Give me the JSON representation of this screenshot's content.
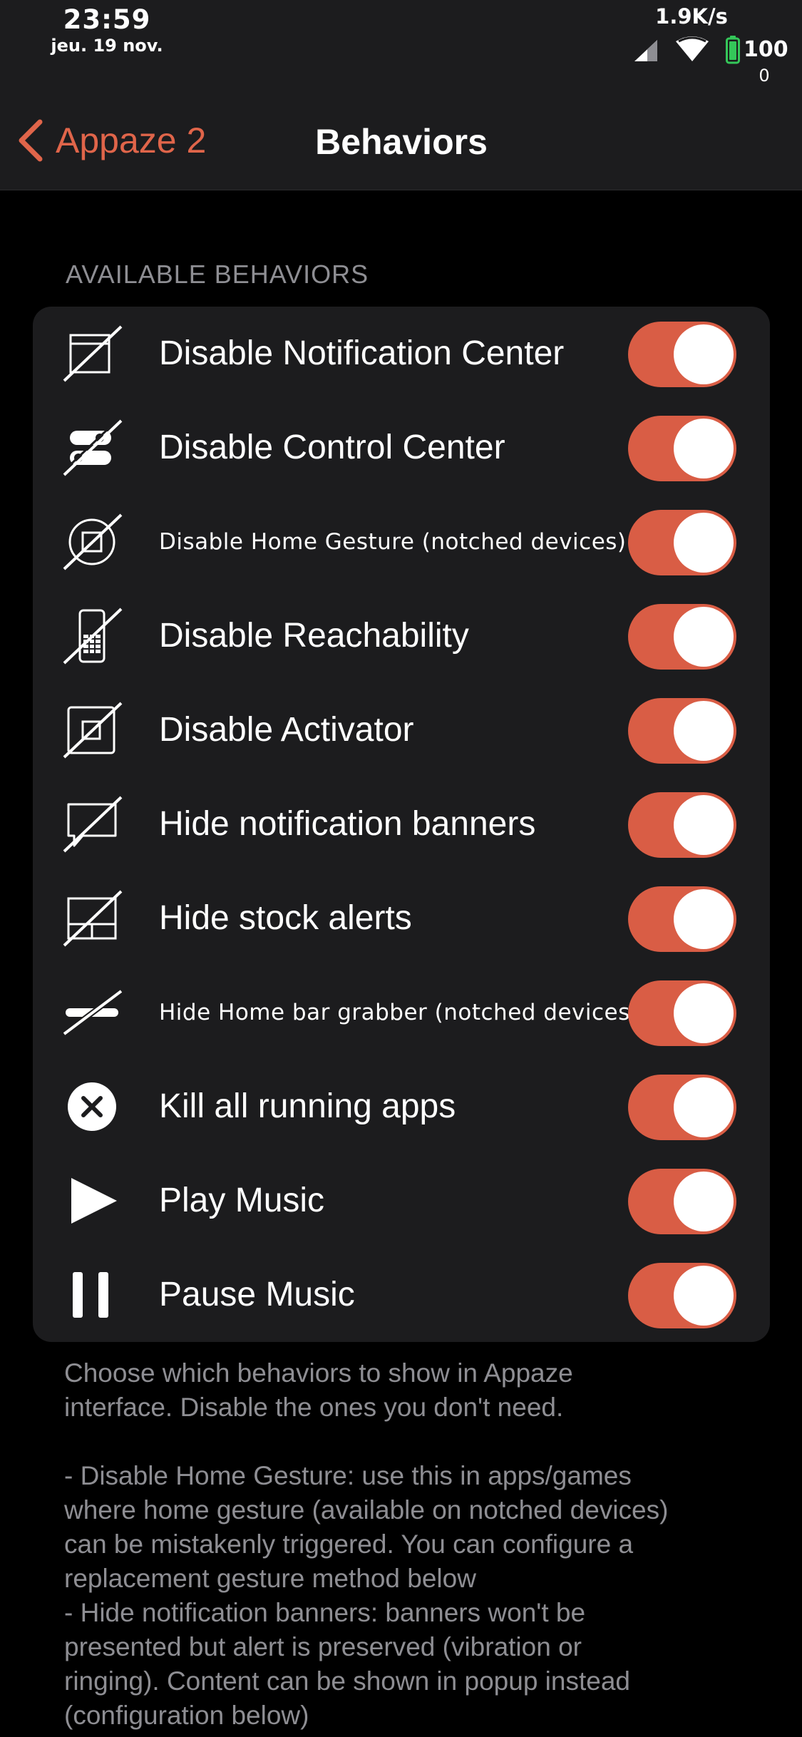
{
  "status_bar": {
    "time": "23:59",
    "date": "jeu. 19 nov.",
    "network_speed": "1.9K/s",
    "battery_level": "100",
    "sub_value": "0",
    "battery_color": "#34c759"
  },
  "nav": {
    "back_label": "Appaze 2",
    "title": "Behaviors",
    "accent_color": "#e0654a"
  },
  "section": {
    "header": "AVAILABLE BEHAVIORS",
    "toggle_on_color": "#d95d45",
    "items": [
      {
        "label": "Disable Notification Center",
        "icon": "notification-center-disabled-icon",
        "enabled": true
      },
      {
        "label": "Disable Control Center",
        "icon": "control-center-disabled-icon",
        "enabled": true
      },
      {
        "label": "Disable Home Gesture (notched devices)",
        "icon": "home-gesture-disabled-icon",
        "enabled": true
      },
      {
        "label": "Disable Reachability",
        "icon": "reachability-disabled-icon",
        "enabled": true
      },
      {
        "label": "Disable Activator",
        "icon": "activator-disabled-icon",
        "enabled": true
      },
      {
        "label": "Hide notification banners",
        "icon": "banner-hidden-icon",
        "enabled": true
      },
      {
        "label": "Hide stock alerts",
        "icon": "alert-hidden-icon",
        "enabled": true
      },
      {
        "label": "Hide Home bar grabber (notched devices)",
        "icon": "home-bar-hidden-icon",
        "enabled": true
      },
      {
        "label": "Kill all running apps",
        "icon": "close-circle-icon",
        "enabled": true
      },
      {
        "label": "Play Music",
        "icon": "play-icon",
        "enabled": true
      },
      {
        "label": "Pause Music",
        "icon": "pause-icon",
        "enabled": true
      }
    ]
  },
  "footer": {
    "intro_line1": "Choose which behaviors to show in Appaze",
    "intro_line2": "interface. Disable the ones you don't need.",
    "note1_line1": "- Disable Home Gesture: use this in apps/games",
    "note1_line2": "where home gesture (available on notched devices)",
    "note1_line3": "can be mistakenly triggered. You can configure a",
    "note1_line4": "replacement gesture method below",
    "note2_line1": "- Hide notification banners: banners won't be",
    "note2_line2": "presented but alert is preserved (vibration or",
    "note2_line3": "ringing). Content can be shown in popup instead",
    "note2_line4": "(configuration below)"
  }
}
